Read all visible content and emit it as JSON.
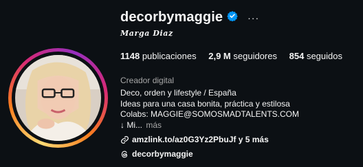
{
  "profile": {
    "username": "decorbymaggie",
    "display_name": "𝑴𝒂𝒓𝒈𝒂 𝑫𝒊𝒂𝒛",
    "stats": [
      {
        "value": "1148",
        "label": "publicaciones"
      },
      {
        "value": "2,9 M",
        "label": "seguidores"
      },
      {
        "value": "854",
        "label": "seguidos"
      }
    ],
    "category": "Creador digital",
    "bio": [
      "Deco, orden y lifestyle / España",
      "Ideas para una casa bonita, práctica y estilosa",
      "Colabs: MAGGIE@SOMOSMADTALENTS.COM"
    ],
    "bio_truncated": "↓ Mi...",
    "bio_more": "más",
    "link_text": "amzlink.to/az0G3Yz2PbuJf y 5 más",
    "threads_handle": "decorbymaggie",
    "options_label": "···"
  },
  "colors": {
    "background": "#0c1014",
    "verified": "#0095f6",
    "secondary_text": "#a8a8a8"
  },
  "icons": [
    "verified-badge-icon",
    "more-options-icon",
    "link-icon",
    "threads-icon"
  ]
}
